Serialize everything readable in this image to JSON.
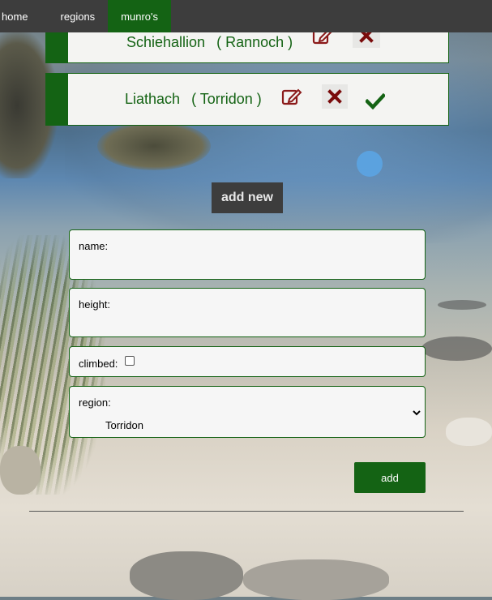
{
  "nav": {
    "items": [
      {
        "label": "home",
        "active": false
      },
      {
        "label": "regions",
        "active": false
      },
      {
        "label": "munro's",
        "active": true
      }
    ]
  },
  "munros": [
    {
      "name": "Schiehallion",
      "region": "( Rannoch )",
      "climbed": false
    },
    {
      "name": "Liathach",
      "region": "( Torridon )",
      "climbed": true
    }
  ],
  "add_section": {
    "heading": "add new",
    "name_label": "name:",
    "name_value": "",
    "height_label": "height:",
    "height_value": "",
    "climbed_label": "climbed:",
    "climbed_checked": false,
    "region_label": "region:",
    "region_value": "Torridon",
    "submit_label": "add"
  },
  "colors": {
    "nav_bg": "#3d3d3d",
    "accent_green": "#146314",
    "edit_red": "#8b1a1a",
    "delete_red": "#7a0c0c",
    "check_green": "#146314"
  },
  "icons": {
    "edit": "edit-icon",
    "delete": "delete-icon",
    "climbed": "check-icon",
    "select": "chevron-down-icon"
  }
}
